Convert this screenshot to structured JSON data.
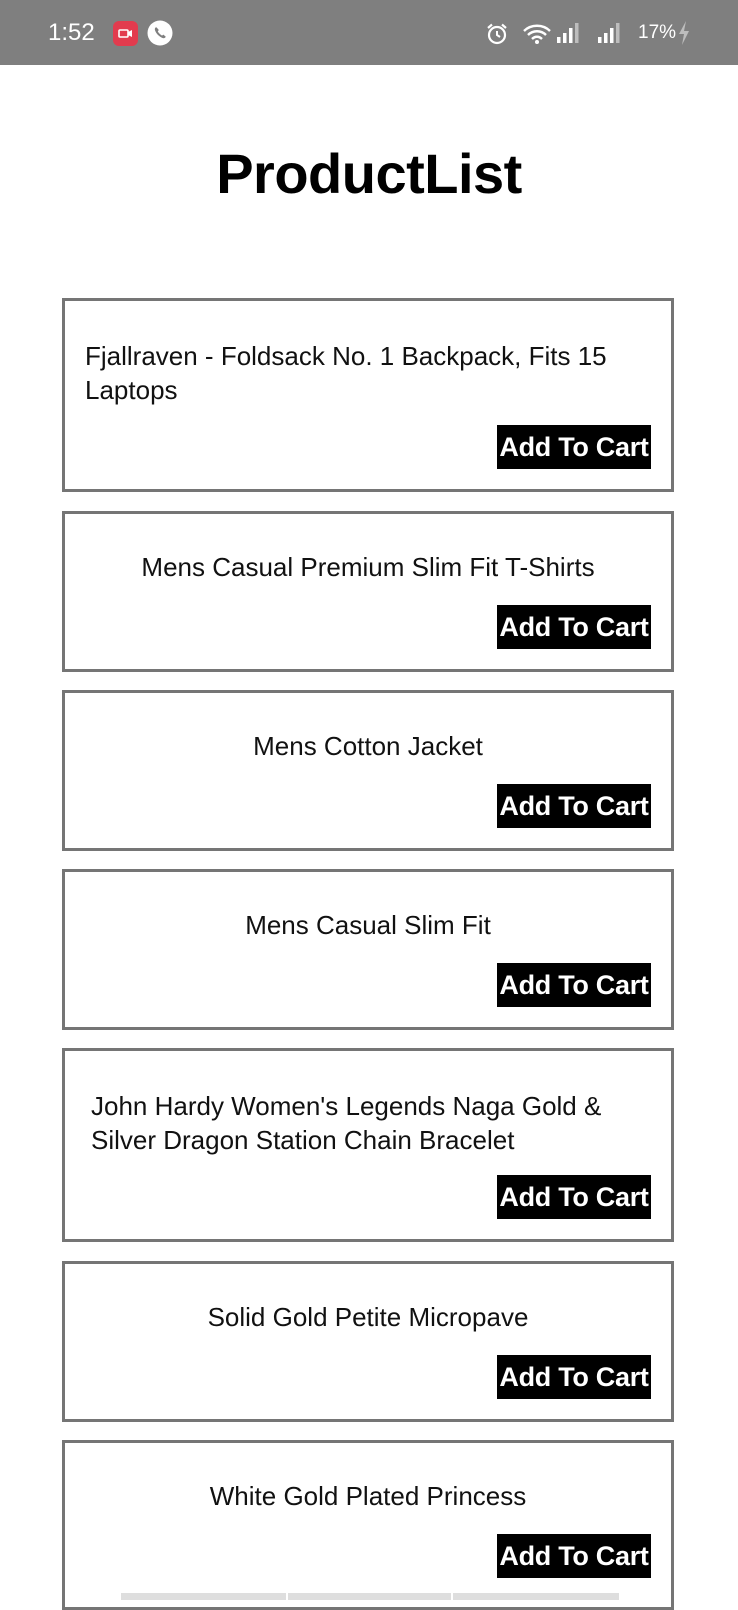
{
  "status_bar": {
    "time": "1:52",
    "battery": "17%",
    "icons": [
      "screen-record-icon",
      "phone-call-icon",
      "alarm-icon",
      "wifi-icon",
      "signal-icon",
      "signal-icon",
      "charging-icon"
    ],
    "colors": {
      "background": "#7f7f7f",
      "record_badge": "#e23b4e"
    }
  },
  "header": {
    "title": "ProductList"
  },
  "products": [
    {
      "name": "Fjallraven - Foldsack No. 1 Backpack, Fits 15 Laptops",
      "button_label": "Add To Cart"
    },
    {
      "name": "Mens Casual Premium Slim Fit T-Shirts",
      "button_label": "Add To Cart"
    },
    {
      "name": "Mens Cotton Jacket",
      "button_label": "Add To Cart"
    },
    {
      "name": "Mens Casual Slim Fit",
      "button_label": "Add To Cart"
    },
    {
      "name": "John Hardy Women's Legends Naga Gold & Silver Dragon Station Chain Bracelet",
      "button_label": "Add To Cart"
    },
    {
      "name": "Solid Gold Petite Micropave",
      "button_label": "Add To Cart"
    },
    {
      "name": "White Gold Plated Princess",
      "button_label": "Add To Cart"
    }
  ]
}
